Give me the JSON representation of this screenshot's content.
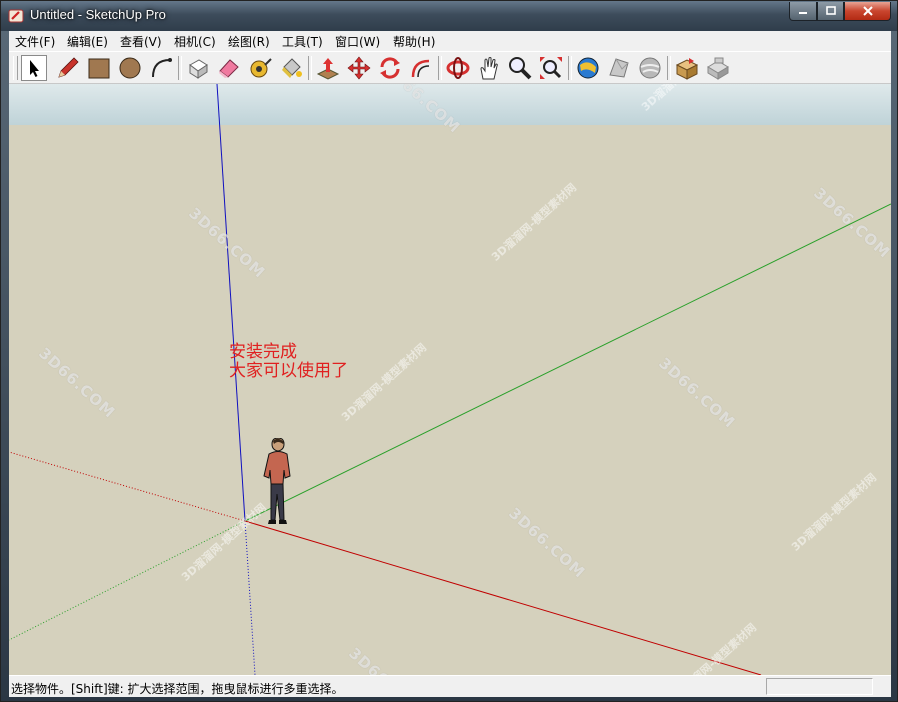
{
  "window": {
    "title": "Untitled - SketchUp Pro"
  },
  "menu": {
    "items": [
      "文件(F)",
      "编辑(E)",
      "查看(V)",
      "相机(C)",
      "绘图(R)",
      "工具(T)",
      "窗口(W)",
      "帮助(H)"
    ]
  },
  "toolbar": {
    "tools": [
      {
        "name": "select",
        "icon": "arrow-cursor-icon",
        "selected": true
      },
      {
        "name": "pencil",
        "icon": "pencil-icon"
      },
      {
        "name": "rectangle",
        "icon": "rectangle-icon"
      },
      {
        "name": "circle",
        "icon": "circle-icon"
      },
      {
        "name": "arc",
        "icon": "arc-icon"
      },
      {
        "name": "make-component",
        "icon": "component-icon"
      },
      {
        "name": "eraser",
        "icon": "eraser-icon"
      },
      {
        "name": "tape-measure",
        "icon": "tape-measure-icon"
      },
      {
        "name": "paint-bucket",
        "icon": "paint-bucket-icon"
      },
      {
        "name": "push-pull",
        "icon": "push-pull-icon"
      },
      {
        "name": "move",
        "icon": "move-icon"
      },
      {
        "name": "rotate",
        "icon": "rotate-icon"
      },
      {
        "name": "offset",
        "icon": "offset-icon"
      },
      {
        "name": "orbit",
        "icon": "orbit-icon"
      },
      {
        "name": "pan",
        "icon": "hand-icon"
      },
      {
        "name": "zoom",
        "icon": "zoom-icon"
      },
      {
        "name": "zoom-extents",
        "icon": "zoom-extents-icon"
      },
      {
        "name": "3d-warehouse",
        "icon": "globe-icon"
      },
      {
        "name": "share-model",
        "icon": "share-model-icon"
      },
      {
        "name": "google-earth",
        "icon": "earth-icon"
      },
      {
        "name": "extension-warehouse",
        "icon": "box-icon"
      },
      {
        "name": "layout",
        "icon": "layout-icon"
      }
    ]
  },
  "canvas": {
    "note_line1": "安装完成",
    "note_line2": "大家可以使用了",
    "watermark_a": "3D66.COM",
    "watermark_b": "3D溜溜网-模型素材网"
  },
  "status": {
    "text": "选择物件。[Shift]键: 扩大选择范围，拖曳鼠标进行多重选择。",
    "measurements": ""
  },
  "colors": {
    "ground": "#d5d1bd",
    "red_axis": "#c00000",
    "green_axis": "#2aa02a",
    "blue_axis": "#1010c0",
    "note_text": "#e02020"
  }
}
